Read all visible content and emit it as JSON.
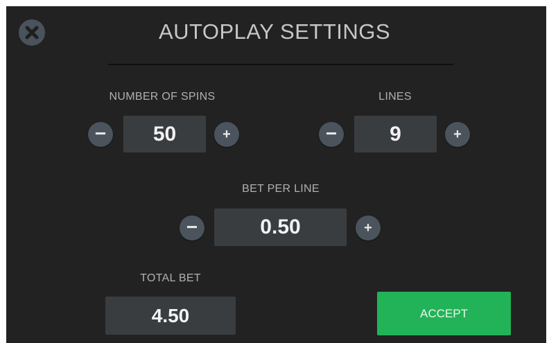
{
  "dialog": {
    "title": "AUTOPLAY SETTINGS",
    "close_icon": "close-icon"
  },
  "spins": {
    "label": "NUMBER OF SPINS",
    "value": "50",
    "minus": "−",
    "plus": "+"
  },
  "lines": {
    "label": "LINES",
    "value": "9",
    "minus": "−",
    "plus": "+"
  },
  "bet_per_line": {
    "label": "BET PER LINE",
    "value": "0.50",
    "minus": "−",
    "plus": "+"
  },
  "total_bet": {
    "label": "TOTAL BET",
    "value": "4.50"
  },
  "accept": {
    "label": "ACCEPT"
  },
  "colors": {
    "background": "#222222",
    "value_box": "#3a3d40",
    "round_button": "#4b545d",
    "accept": "#22b358"
  }
}
